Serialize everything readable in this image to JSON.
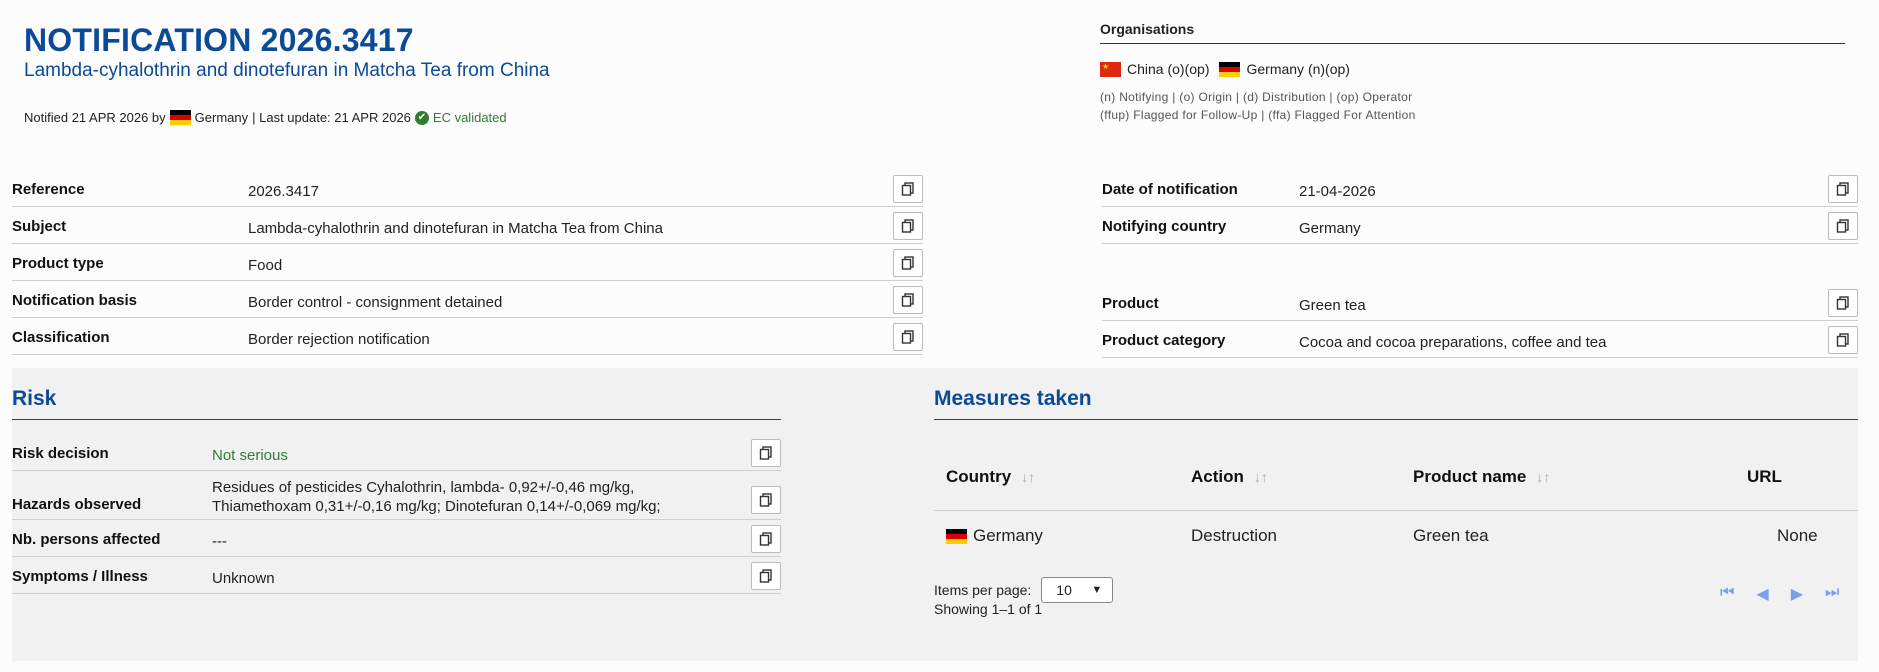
{
  "header": {
    "title": "NOTIFICATION 2026.3417",
    "subtitle": "Lambda-cyhalothrin and dinotefuran in Matcha Tea from China",
    "notified_prefix": "Notified 21 APR 2026 by",
    "notified_country": "Germany",
    "last_update": "| Last update: 21 APR 2026",
    "validated": "EC validated"
  },
  "organisations": {
    "title": "Organisations",
    "items": [
      {
        "flag": "flag-china",
        "label": "China (o)(op)"
      },
      {
        "flag": "flag-germany",
        "label": "Germany (n)(op)"
      }
    ],
    "legend1": "(n) Notifying | (o) Origin | (d) Distribution | (op) Operator",
    "legend2": "(ffup) Flagged for Follow-Up | (ffa) Flagged For Attention"
  },
  "details_left": [
    {
      "label": "Reference",
      "value": "2026.3417"
    },
    {
      "label": "Subject",
      "value": "Lambda-cyhalothrin and dinotefuran in Matcha Tea from China"
    },
    {
      "label": "Product type",
      "value": "Food"
    },
    {
      "label": "Notification basis",
      "value": "Border control - consignment detained"
    },
    {
      "label": "Classification",
      "value": "Border rejection notification"
    }
  ],
  "details_right": [
    {
      "label": "Date of notification",
      "value": "21-04-2026"
    },
    {
      "label": "Notifying country",
      "value": "Germany"
    },
    {
      "label": "Product",
      "value": "Green tea"
    },
    {
      "label": "Product category",
      "value": "Cocoa and cocoa preparations, coffee and tea"
    }
  ],
  "risk": {
    "title": "Risk",
    "rows": [
      {
        "label": "Risk decision",
        "value": "Not serious"
      },
      {
        "label": "Hazards observed",
        "value_line1": "Residues of pesticides Cyhalothrin, lambda- 0,92+/-0,46 mg/kg,",
        "value_line2": "Thiamethoxam 0,31+/-0,16 mg/kg; Dinotefuran 0,14+/-0,069 mg/kg;"
      },
      {
        "label": "Nb. persons affected",
        "value": "---"
      },
      {
        "label": "Symptoms / Illness",
        "value": "Unknown"
      }
    ],
    "colors": {
      "not_serious": "#2e7d32"
    }
  },
  "measures": {
    "title": "Measures taken",
    "columns": [
      "Country",
      "Action",
      "Product name",
      "URL"
    ],
    "rows": [
      {
        "country": "Germany",
        "action": "Destruction",
        "product_name": "Green tea",
        "url": "None"
      }
    ],
    "items_per_page_label": "Items per page:",
    "items_per_page": "10",
    "showing": "Showing 1–1 of 1"
  },
  "colors": {
    "accent": "#0b4a94",
    "validated": "#2e7d32",
    "pager": "#7aa0e8"
  }
}
